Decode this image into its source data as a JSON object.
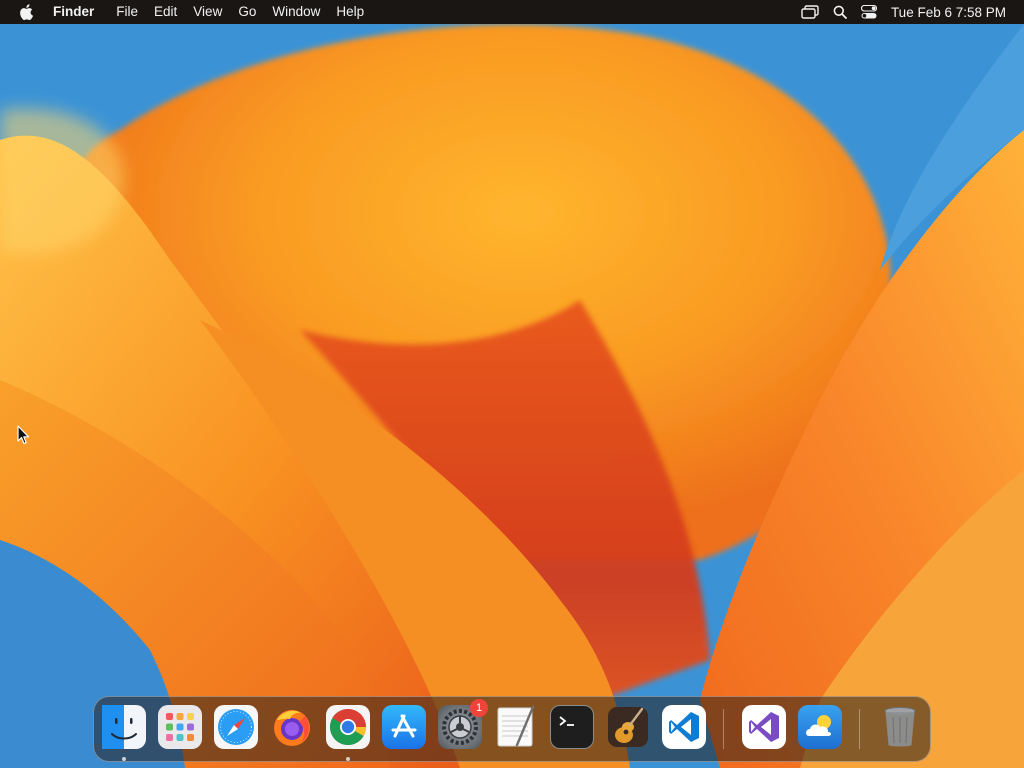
{
  "menubar": {
    "apple_icon": "apple-logo-icon",
    "app_name": "Finder",
    "menus": [
      "File",
      "Edit",
      "View",
      "Go",
      "Window",
      "Help"
    ],
    "status_icons": [
      "screen-mirroring-icon",
      "spotlight-search-icon",
      "control-center-icon"
    ],
    "clock": "Tue Feb 6  7:58 PM"
  },
  "dock": {
    "apps": [
      {
        "name": "Finder",
        "icon": "finder-icon",
        "running": true
      },
      {
        "name": "Launchpad",
        "icon": "launchpad-icon",
        "running": false
      },
      {
        "name": "Safari",
        "icon": "safari-icon",
        "running": false
      },
      {
        "name": "Firefox",
        "icon": "firefox-icon",
        "running": false
      },
      {
        "name": "Google Chrome",
        "icon": "chrome-icon",
        "running": true
      },
      {
        "name": "App Store",
        "icon": "app-store-icon",
        "running": false
      },
      {
        "name": "System Settings",
        "icon": "system-settings-icon",
        "running": false,
        "badge": "1"
      },
      {
        "name": "TextEdit",
        "icon": "textedit-icon",
        "running": false
      },
      {
        "name": "Terminal",
        "icon": "terminal-icon",
        "running": false
      },
      {
        "name": "GarageBand",
        "icon": "garageband-icon",
        "running": false
      },
      {
        "name": "Visual Studio Code",
        "icon": "vscode-icon",
        "running": false
      }
    ],
    "recent": [
      {
        "name": "Visual Studio",
        "icon": "visual-studio-icon"
      },
      {
        "name": "Weather",
        "icon": "weather-icon"
      }
    ],
    "trash": {
      "name": "Trash",
      "icon": "trash-icon"
    }
  },
  "colors": {
    "menubar_bg": "#1a1614",
    "wallpaper_orange": "#f7941d",
    "wallpaper_blue": "#3a93d6",
    "badge_red": "#f0433a"
  }
}
